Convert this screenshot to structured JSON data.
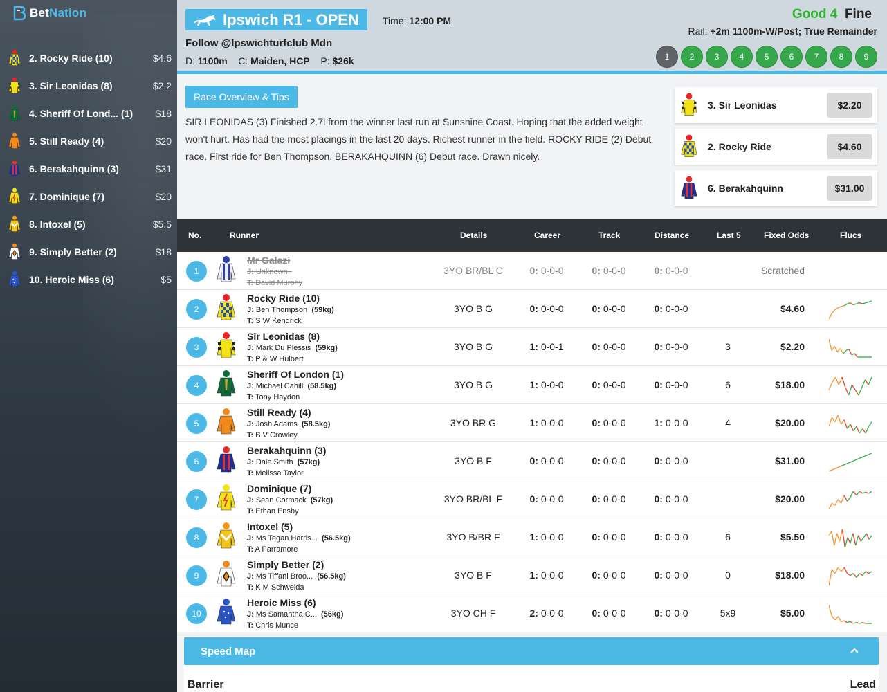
{
  "brand": {
    "name_a": "Bet",
    "name_b": "Nation"
  },
  "sidebar": {
    "items": [
      {
        "label": "2. Rocky Ride  (10)",
        "odds": "$4.6",
        "silk": "checker"
      },
      {
        "label": "3. Sir Leonidas  (8)",
        "odds": "$2.2",
        "silk": "yellow"
      },
      {
        "label": "4. Sheriff Of Lond...  (1)",
        "odds": "$18",
        "silk": "green"
      },
      {
        "label": "5. Still Ready  (4)",
        "odds": "$20",
        "silk": "orange"
      },
      {
        "label": "6. Berakahquinn  (3)",
        "odds": "$31",
        "silk": "stripes"
      },
      {
        "label": "7. Dominique  (7)",
        "odds": "$20",
        "silk": "redyellow"
      },
      {
        "label": "8. Intoxel  (5)",
        "odds": "$5.5",
        "silk": "chevron"
      },
      {
        "label": "9. Simply Better  (2)",
        "odds": "$18",
        "silk": "diamond"
      },
      {
        "label": "10. Heroic Miss  (6)",
        "odds": "$5",
        "silk": "bluestar"
      }
    ]
  },
  "header": {
    "title": "Ipswich R1 - OPEN",
    "time_label": "Time:",
    "time_value": "12:00 PM",
    "follow": "Follow @Ipswichturfclub Mdn",
    "distance_label": "D:",
    "distance_value": "1100m",
    "class_label": "C:",
    "class_value": "Maiden, HCP",
    "prize_label": "P:",
    "prize_value": "$26k",
    "track_condition": "Good 4",
    "weather": "Fine",
    "rail_label": "Rail:",
    "rail_value": "+2m 1100m-W/Post; True Remainder",
    "races": [
      "1",
      "2",
      "3",
      "4",
      "5",
      "6",
      "7",
      "8",
      "9"
    ],
    "active_race": "1"
  },
  "overview": {
    "button": "Race Overview & Tips",
    "text": "SIR LEONIDAS (3) Finished 2.7l from the winner last run at Sunshine Coast. Hoping that the added weight won't hurt. Has had the most placings in the last 20 days. Richest runner in the field. ROCKY RIDE (2) Debut race. First ride for Ben Thompson. BERAKAHQUINN (6) Debut race. Drawn nicely.",
    "tips": [
      {
        "label": "3. Sir Leonidas",
        "price": "$2.20",
        "silk": "yellow"
      },
      {
        "label": "2. Rocky Ride",
        "price": "$4.60",
        "silk": "checker"
      },
      {
        "label": "6. Berakahquinn",
        "price": "$31.00",
        "silk": "stripes"
      }
    ]
  },
  "table": {
    "headers": {
      "no": "No.",
      "runner": "Runner",
      "details": "Details",
      "career": "Career",
      "track": "Track",
      "distance": "Distance",
      "last5": "Last 5",
      "odds": "Fixed Odds",
      "flucs": "Flucs"
    },
    "rows": [
      {
        "no": "1",
        "name": "Mr Galazi",
        "j_label": "J:",
        "jockey": "Unknown",
        "weight": "",
        "t_label": "T:",
        "trainer": "David Murphy",
        "details": "3YO BR/BL C",
        "career_a": "0:",
        "career_b": "0-0-0",
        "track_a": "0:",
        "track_b": "0-0-0",
        "dist_a": "0:",
        "dist_b": "0-0-0",
        "last5": "",
        "odds": "Scratched",
        "scratched": true,
        "silk": "whiteblue",
        "flucs": []
      },
      {
        "no": "2",
        "name": "Rocky Ride  (10)",
        "j_label": "J:",
        "jockey": "Ben Thompson",
        "weight": "(59kg)",
        "t_label": "T:",
        "trainer": "S W Kendrick",
        "details": "3YO B G",
        "career_a": "0:",
        "career_b": "0-0-0",
        "track_a": "0:",
        "track_b": "0-0-0",
        "dist_a": "0:",
        "dist_b": "0-0-0",
        "last5": "",
        "odds": "$4.60",
        "silk": "checker",
        "flucs": [
          4,
          10,
          14,
          16,
          17,
          18,
          20,
          21,
          19,
          20,
          21,
          20,
          21,
          22,
          23
        ]
      },
      {
        "no": "3",
        "name": "Sir Leonidas  (8)",
        "j_label": "J:",
        "jockey": "Mark Du Plessis",
        "weight": "(59kg)",
        "t_label": "T:",
        "trainer": "P & W Hulbert",
        "details": "3YO B G",
        "career_a": "1:",
        "career_b": "0-0-1",
        "track_a": "0:",
        "track_b": "0-0-0",
        "dist_a": "0:",
        "dist_b": "0-0-0",
        "last5": "3",
        "odds": "$2.20",
        "silk": "yellow",
        "flucs": [
          28,
          12,
          18,
          10,
          15,
          8,
          12,
          14,
          6,
          8,
          3,
          3,
          3,
          3,
          3,
          3
        ]
      },
      {
        "no": "4",
        "name": "Sheriff Of London  (1)",
        "j_label": "J:",
        "jockey": "Michael Cahill",
        "weight": "(58.5kg)",
        "t_label": "T:",
        "trainer": "Tony Haydon",
        "details": "3YO B G",
        "career_a": "1:",
        "career_b": "0-0-0",
        "track_a": "0:",
        "track_b": "0-0-0",
        "dist_a": "0:",
        "dist_b": "0-0-0",
        "last5": "6",
        "odds": "$18.00",
        "silk": "green",
        "flucs": [
          10,
          16,
          20,
          14,
          20,
          12,
          6,
          14,
          10,
          6,
          12,
          18,
          14,
          20
        ]
      },
      {
        "no": "5",
        "name": "Still Ready  (4)",
        "j_label": "J:",
        "jockey": "Josh Adams",
        "weight": "(58.5kg)",
        "t_label": "T:",
        "trainer": "B V Crowley",
        "details": "3YO BR G",
        "career_a": "1:",
        "career_b": "0-0-0",
        "track_a": "0:",
        "track_b": "0-0-0",
        "dist_a": "1:",
        "dist_b": "0-0-0",
        "last5": "4",
        "odds": "$20.00",
        "silk": "orange",
        "flucs": [
          12,
          20,
          16,
          22,
          14,
          18,
          10,
          14,
          8,
          12,
          6,
          10,
          6,
          12,
          16
        ]
      },
      {
        "no": "6",
        "name": "Berakahquinn  (3)",
        "j_label": "J:",
        "jockey": "Dale Smith",
        "weight": "(57kg)",
        "t_label": "T:",
        "trainer": "Melissa Taylor",
        "details": "3YO B F",
        "career_a": "0:",
        "career_b": "0-0-0",
        "track_a": "0:",
        "track_b": "0-0-0",
        "dist_a": "0:",
        "dist_b": "0-0-0",
        "last5": "",
        "odds": "$31.00",
        "silk": "stripes",
        "flucs": [
          4,
          6,
          8,
          10,
          12,
          14,
          16,
          18,
          20,
          22,
          24
        ]
      },
      {
        "no": "7",
        "name": "Dominique  (7)",
        "j_label": "J:",
        "jockey": "Sean Cormack",
        "weight": "(57kg)",
        "t_label": "T:",
        "trainer": "Ethan Ensby",
        "details": "3YO BR/BL F",
        "career_a": "0:",
        "career_b": "0-0-0",
        "track_a": "0:",
        "track_b": "0-0-0",
        "dist_a": "0:",
        "dist_b": "0-0-0",
        "last5": "",
        "odds": "$20.00",
        "silk": "redyellow",
        "flucs": [
          6,
          12,
          10,
          16,
          12,
          20,
          14,
          18,
          24,
          20,
          24,
          22,
          23,
          22,
          24
        ]
      },
      {
        "no": "8",
        "name": "Intoxel  (5)",
        "j_label": "J:",
        "jockey": "Ms Tegan Harris...",
        "weight": "(56.5kg)",
        "t_label": "T:",
        "trainer": "A Parramore",
        "details": "3YO B/BR F",
        "career_a": "1:",
        "career_b": "0-0-0",
        "track_a": "0:",
        "track_b": "0-0-0",
        "dist_a": "0:",
        "dist_b": "0-0-0",
        "last5": "6",
        "odds": "$5.50",
        "silk": "chevron",
        "flucs": [
          20,
          24,
          10,
          22,
          14,
          26,
          8,
          18,
          12,
          22,
          10,
          20,
          14,
          18,
          22,
          16,
          20
        ]
      },
      {
        "no": "9",
        "name": "Simply Better  (2)",
        "j_label": "J:",
        "jockey": "Ms Tiffani Broo...",
        "weight": "(56.5kg)",
        "t_label": "T:",
        "trainer": "K M Schweida",
        "details": "3YO B F",
        "career_a": "1:",
        "career_b": "0-0-0",
        "track_a": "0:",
        "track_b": "0-0-0",
        "dist_a": "0:",
        "dist_b": "0-0-0",
        "last5": "0",
        "odds": "$18.00",
        "silk": "diamond",
        "flucs": [
          6,
          22,
          18,
          24,
          20,
          24,
          18,
          16,
          18,
          14,
          18,
          16,
          20,
          18,
          20
        ]
      },
      {
        "no": "10",
        "name": "Heroic Miss  (6)",
        "j_label": "J:",
        "jockey": "Ms Samantha C...",
        "weight": "(56kg)",
        "t_label": "T:",
        "trainer": "Chris Munce",
        "details": "3YO CH F",
        "career_a": "2:",
        "career_b": "0-0-0",
        "track_a": "0:",
        "track_b": "0-0-0",
        "dist_a": "0:",
        "dist_b": "0-0-0",
        "last5": "5x9",
        "odds": "$5.00",
        "silk": "bluestar",
        "flucs": [
          26,
          14,
          10,
          14,
          8,
          9,
          7,
          8,
          6,
          7,
          6,
          7,
          6,
          6,
          6
        ]
      }
    ]
  },
  "speedmap": {
    "title": "Speed Map",
    "barrier": "Barrier",
    "lead": "Lead"
  },
  "colors": {
    "accent": "#4cb8e6",
    "good": "#32b432",
    "green_btn": "#36a74a",
    "header_bg": "#cfd8de",
    "table_head": "#2e3337"
  }
}
